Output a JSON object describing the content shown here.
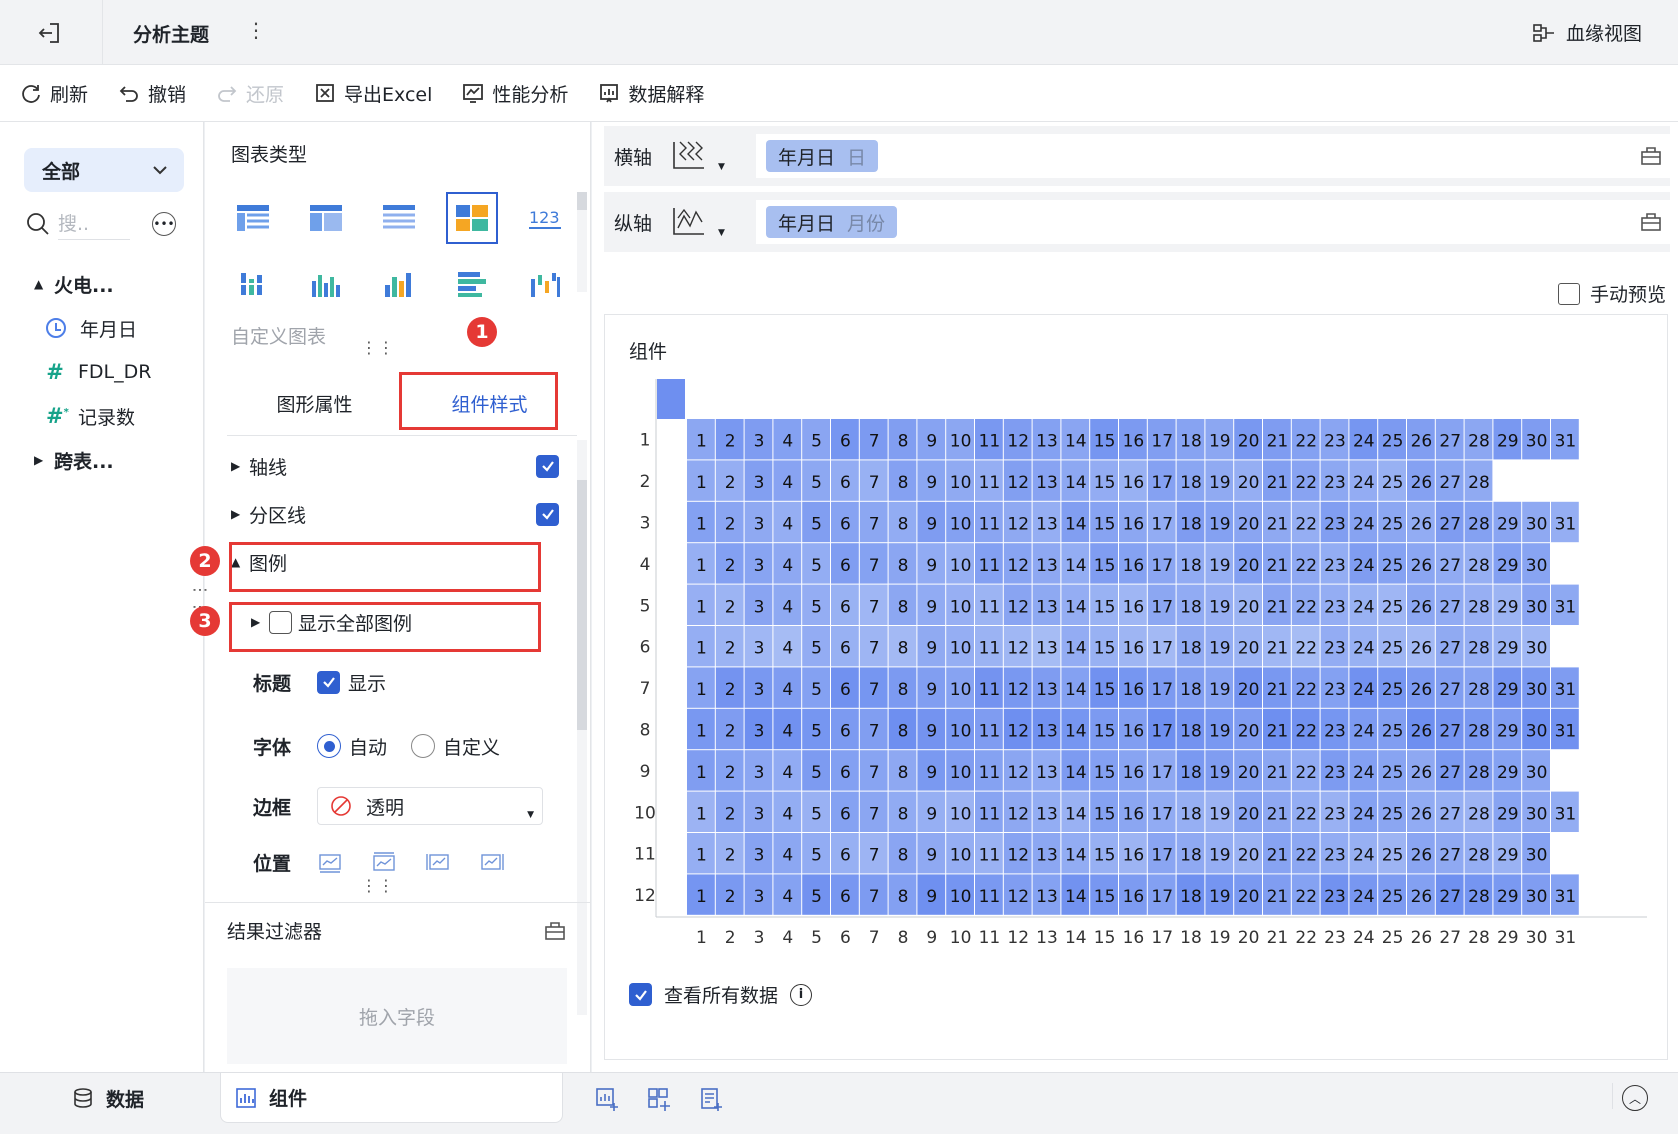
{
  "topbar": {
    "title": "分析主题",
    "more": "⋮",
    "lineage": "血缘视图"
  },
  "toolbar": {
    "refresh": "刷新",
    "undo": "撤销",
    "redo": "还原",
    "export": "导出Excel",
    "perf": "性能分析",
    "explain": "数据解释"
  },
  "left": {
    "scope": "全部",
    "search_placeholder": "搜..",
    "groups": [
      {
        "label": "火电...",
        "items": [
          {
            "label": "年月日",
            "icon": "clock-icon"
          },
          {
            "label": "FDL_DR",
            "icon": "hash-icon"
          },
          {
            "label": "记录数",
            "icon": "hash-star-icon"
          }
        ]
      },
      {
        "label": "跨表...",
        "items": []
      }
    ]
  },
  "mid": {
    "chart_type_title": "图表类型",
    "custom_chart": "自定义图表",
    "tabs": [
      "图形属性",
      "组件样式"
    ],
    "rows": {
      "axis": "轴线",
      "division": "分区线",
      "legend": "图例",
      "show_all_legend": "显示全部图例"
    },
    "title_label": "标题",
    "title_show": "显示",
    "font_label": "字体",
    "font_auto": "自动",
    "font_custom": "自定义",
    "border_label": "边框",
    "border_value": "透明",
    "position_label": "位置",
    "filter_title": "结果过滤器",
    "drop_hint": "拖入字段",
    "badges": [
      "1",
      "2",
      "3"
    ]
  },
  "right": {
    "x_axis_label": "横轴",
    "x_field": "年月日",
    "x_sub": "日",
    "y_axis_label": "纵轴",
    "y_field": "年月日",
    "y_sub": "月份",
    "manual_preview": "手动预览",
    "card_title": "组件",
    "view_all": "查看所有数据",
    "info": "i"
  },
  "chart_data": {
    "type": "heatmap",
    "x_categories": [
      1,
      2,
      3,
      4,
      5,
      6,
      7,
      8,
      9,
      10,
      11,
      12,
      13,
      14,
      15,
      16,
      17,
      18,
      19,
      20,
      21,
      22,
      23,
      24,
      25,
      26,
      27,
      28,
      29,
      30,
      31
    ],
    "y_categories": [
      1,
      2,
      3,
      4,
      5,
      6,
      7,
      8,
      9,
      10,
      11,
      12
    ],
    "days_in_month": [
      31,
      28,
      31,
      30,
      31,
      30,
      31,
      31,
      30,
      31,
      30,
      31
    ],
    "row_shade": [
      0.72,
      0.55,
      0.6,
      0.58,
      0.45,
      0.35,
      0.8,
      0.88,
      0.66,
      0.5,
      0.48,
      0.82
    ],
    "color_low": "#b3c6f5",
    "color_high": "#6e8ff0"
  },
  "bottom": {
    "data_tab": "数据",
    "component_tab": "组件"
  }
}
